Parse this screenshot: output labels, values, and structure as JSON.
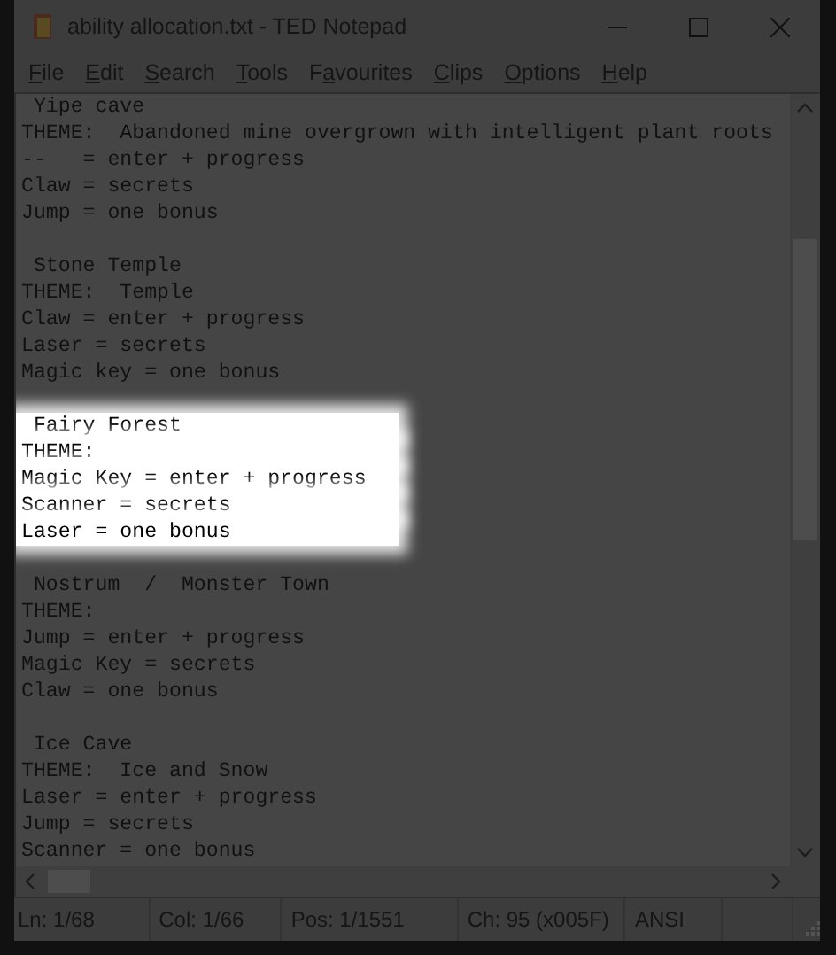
{
  "window": {
    "title": "ability allocation.txt - TED Notepad"
  },
  "menu": [
    {
      "key": "F",
      "after": "ile"
    },
    {
      "key": "E",
      "after": "dit"
    },
    {
      "key": "S",
      "after": "earch"
    },
    {
      "key": "T",
      "after": "ools"
    },
    {
      "before": "F",
      "key": "a",
      "after": "vourites"
    },
    {
      "key": "C",
      "after": "lips"
    },
    {
      "key": "O",
      "after": "ptions"
    },
    {
      "key": "H",
      "after": "elp"
    }
  ],
  "lines": [
    {
      "kind": "text",
      "text": " Yipe cave",
      "highlighted": false
    },
    {
      "kind": "text",
      "text": "THEME:  Abandoned mine overgrown with intelligent plant roots",
      "highlighted": false
    },
    {
      "kind": "text",
      "text": "--   = enter + progress",
      "highlighted": false
    },
    {
      "kind": "text",
      "text": "Claw = secrets",
      "highlighted": false
    },
    {
      "kind": "text",
      "text": "Jump = one bonus",
      "highlighted": false
    },
    {
      "kind": "blank",
      "highlighted": false
    },
    {
      "kind": "text",
      "text": " Stone Temple",
      "highlighted": false
    },
    {
      "kind": "text",
      "text": "THEME:  Temple",
      "highlighted": false
    },
    {
      "kind": "text",
      "text": "Claw = enter + progress",
      "highlighted": false
    },
    {
      "kind": "text",
      "text": "Laser = secrets",
      "highlighted": false
    },
    {
      "kind": "text",
      "text": "Magic key = one bonus",
      "highlighted": false
    },
    {
      "kind": "blank",
      "highlighted": false
    },
    {
      "kind": "text",
      "text": " Fairy Forest",
      "highlighted": true
    },
    {
      "kind": "text",
      "text": "THEME:",
      "highlighted": true
    },
    {
      "kind": "text",
      "text": "Magic Key = enter + progress",
      "highlighted": true
    },
    {
      "kind": "text",
      "text": "Scanner = secrets",
      "highlighted": true
    },
    {
      "kind": "text",
      "text": "Laser = one bonus",
      "highlighted": true
    },
    {
      "kind": "blank",
      "highlighted": false
    },
    {
      "kind": "text",
      "text": " Nostrum  /  Monster Town",
      "highlighted": false
    },
    {
      "kind": "text",
      "text": "THEME:",
      "highlighted": false
    },
    {
      "kind": "text",
      "text": "Jump = enter + progress",
      "highlighted": false
    },
    {
      "kind": "text",
      "text": "Magic Key = secrets",
      "highlighted": false
    },
    {
      "kind": "text",
      "text": "Claw = one bonus",
      "highlighted": false
    },
    {
      "kind": "blank",
      "highlighted": false
    },
    {
      "kind": "text",
      "text": " Ice Cave",
      "highlighted": false
    },
    {
      "kind": "text",
      "text": "THEME:  Ice and Snow",
      "highlighted": false
    },
    {
      "kind": "text",
      "text": "Laser = enter + progress",
      "highlighted": false
    },
    {
      "kind": "text",
      "text": "Jump = secrets",
      "highlighted": false
    },
    {
      "kind": "text",
      "text": "Scanner = one bonus",
      "highlighted": false
    }
  ],
  "status_bar": [
    "Ln: 1/68",
    "Col: 1/66",
    "Pos: 1/1551",
    "Ch: 95 (x005F)",
    "ANSI"
  ]
}
